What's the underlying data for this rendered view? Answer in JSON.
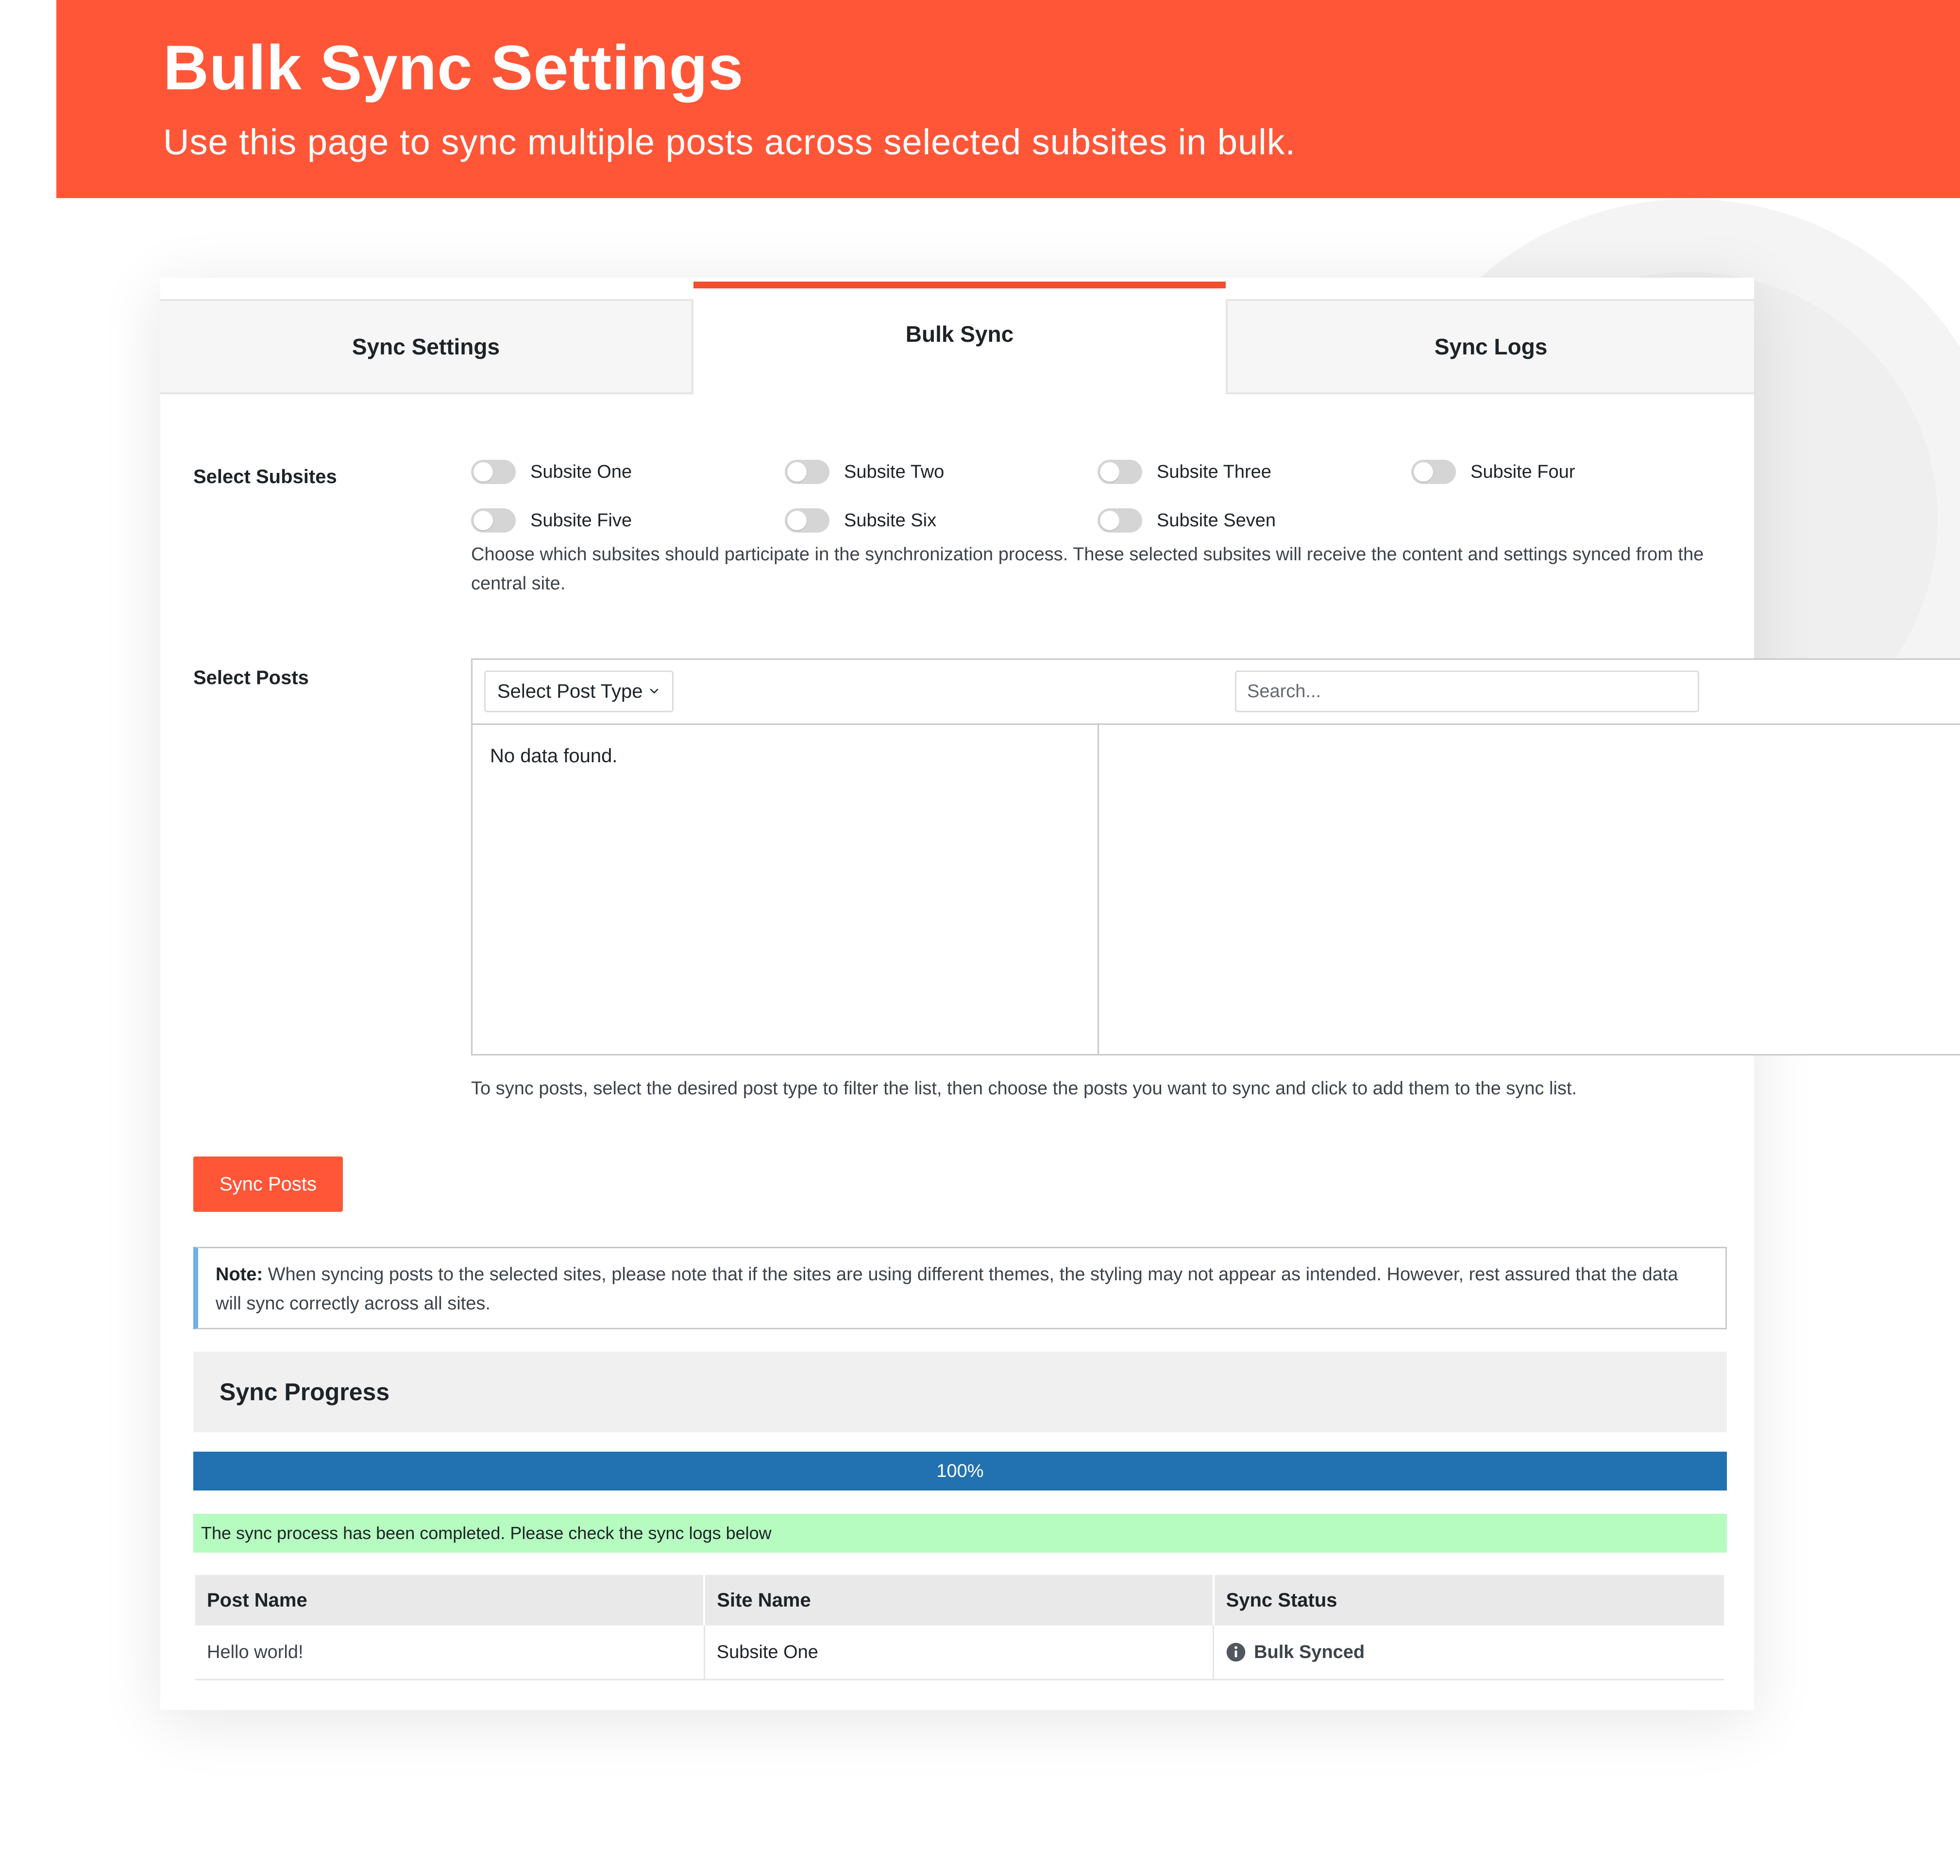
{
  "banner": {
    "title": "Bulk Sync Settings",
    "subtitle": "Use this page to sync multiple posts across selected subsites in bulk."
  },
  "tabs": [
    {
      "label": "Sync Settings",
      "active": false
    },
    {
      "label": "Bulk Sync",
      "active": true
    },
    {
      "label": "Sync Logs",
      "active": false
    }
  ],
  "subsites": {
    "label": "Select Subsites",
    "items": [
      {
        "label": "Subsite One",
        "enabled": false
      },
      {
        "label": "Subsite Two",
        "enabled": false
      },
      {
        "label": "Subsite Three",
        "enabled": false
      },
      {
        "label": "Subsite Four",
        "enabled": false
      },
      {
        "label": "Subsite Five",
        "enabled": false
      },
      {
        "label": "Subsite Six",
        "enabled": false
      },
      {
        "label": "Subsite Seven",
        "enabled": false
      }
    ],
    "help": "Choose which subsites should participate in the synchronization process. These selected subsites will receive the content and settings synced from the central site."
  },
  "posts": {
    "label": "Select Posts",
    "post_type_select": "Select Post Type",
    "search_placeholder": "Search...",
    "search_value": "",
    "empty_text": "No data found.",
    "help": "To sync posts, select the desired post type to filter the list, then choose the posts you want to sync and click to add them to the sync list."
  },
  "sync_button_label": "Sync Posts",
  "note": {
    "prefix": "Note:",
    "text": " When syncing posts to the selected sites, please note that if the sites are using different themes, the styling may not appear as intended. However, rest assured that the data will sync correctly across all sites."
  },
  "progress": {
    "title": "Sync Progress",
    "percent": 100,
    "percent_text": "100%",
    "status_message": "The sync process has been completed. Please check the sync logs below"
  },
  "logs": {
    "columns": [
      "Post Name",
      "Site Name",
      "Sync Status"
    ],
    "rows": [
      {
        "post_name": "Hello world!",
        "site_name": "Subsite One",
        "status": "Bulk Synced",
        "status_icon": "info-icon"
      }
    ]
  },
  "colors": {
    "brand": "#ff5638",
    "progress": "#2271b1",
    "success_bg": "#b6fcc0",
    "note_border": "#72aee6"
  }
}
